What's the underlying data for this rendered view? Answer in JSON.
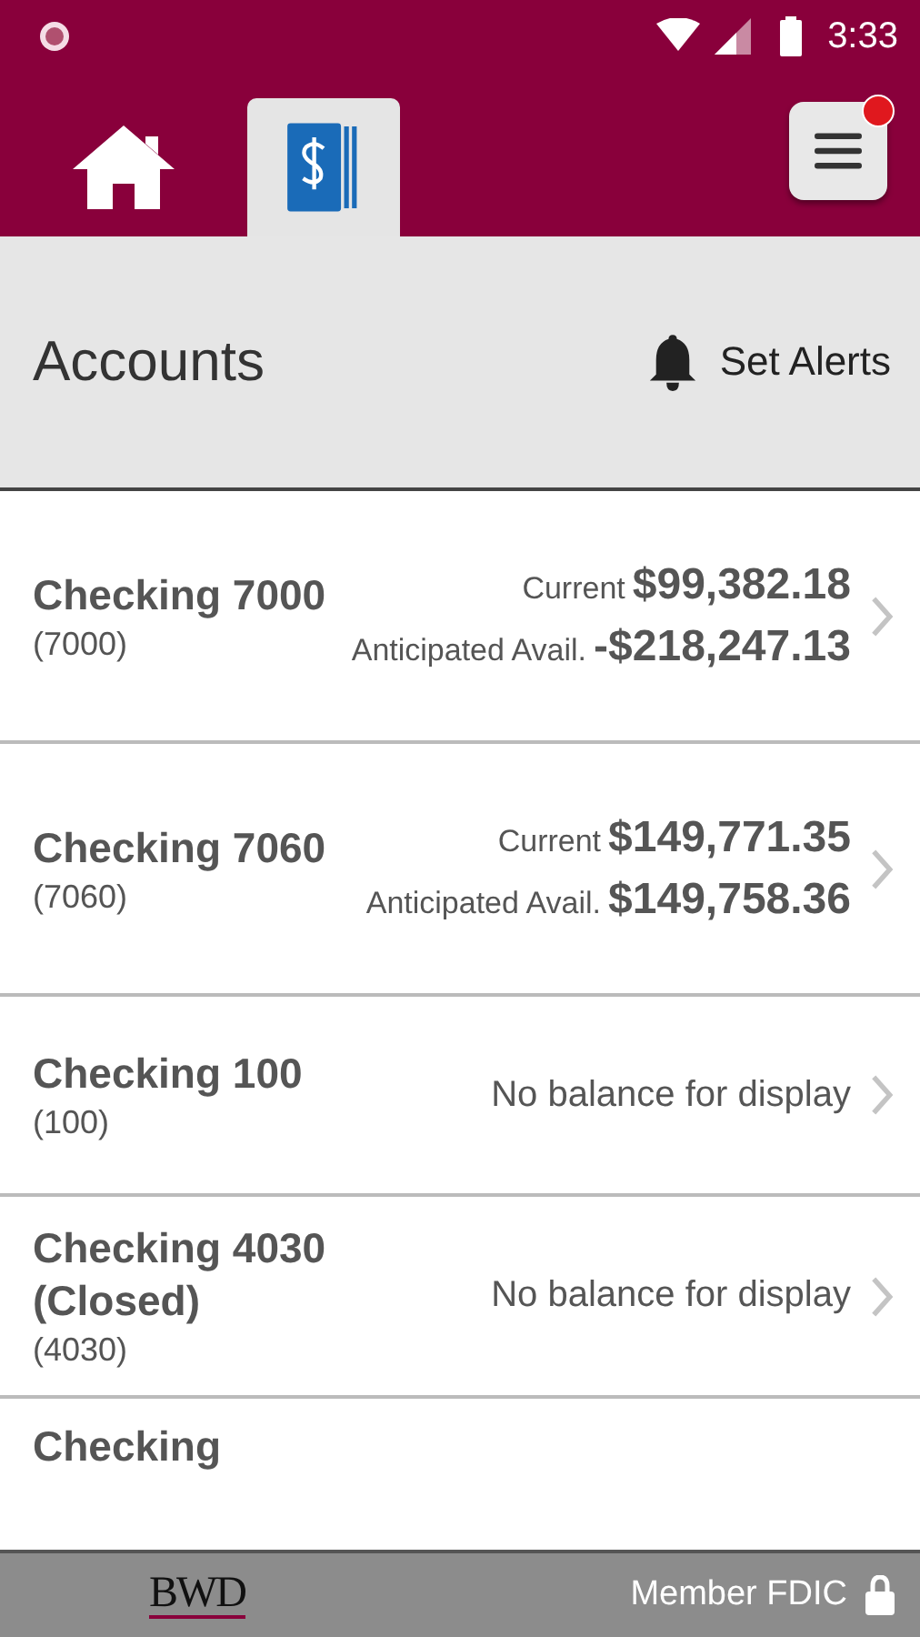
{
  "status_bar": {
    "time": "3:33"
  },
  "tabs": [
    {
      "kind": "home",
      "selected": false
    },
    {
      "kind": "accounts",
      "selected": true
    }
  ],
  "menu": {
    "notification": true
  },
  "header": {
    "title": "Accounts",
    "action": "Set Alerts"
  },
  "accounts": [
    {
      "kind": "balances",
      "name": "Checking 7000",
      "number": "(7000)",
      "balances": [
        {
          "label": "Current",
          "amount": "$99,382.18"
        },
        {
          "label": "Anticipated Avail.",
          "amount": "-$218,247.13"
        }
      ]
    },
    {
      "kind": "balances",
      "name": "Checking 7060",
      "number": "(7060)",
      "balances": [
        {
          "label": "Current",
          "amount": "$149,771.35"
        },
        {
          "label": "Anticipated Avail.",
          "amount": "$149,758.36"
        }
      ]
    },
    {
      "kind": "message",
      "name": "Checking 100",
      "number": "(100)",
      "message": "No balance for display"
    },
    {
      "kind": "message",
      "name": "Checking 4030 (Closed)",
      "number": "(4030)",
      "message": "No balance for display"
    },
    {
      "kind": "partial",
      "name": "Checking"
    }
  ],
  "footer": {
    "logo": "BWD",
    "text": "Member FDIC"
  }
}
